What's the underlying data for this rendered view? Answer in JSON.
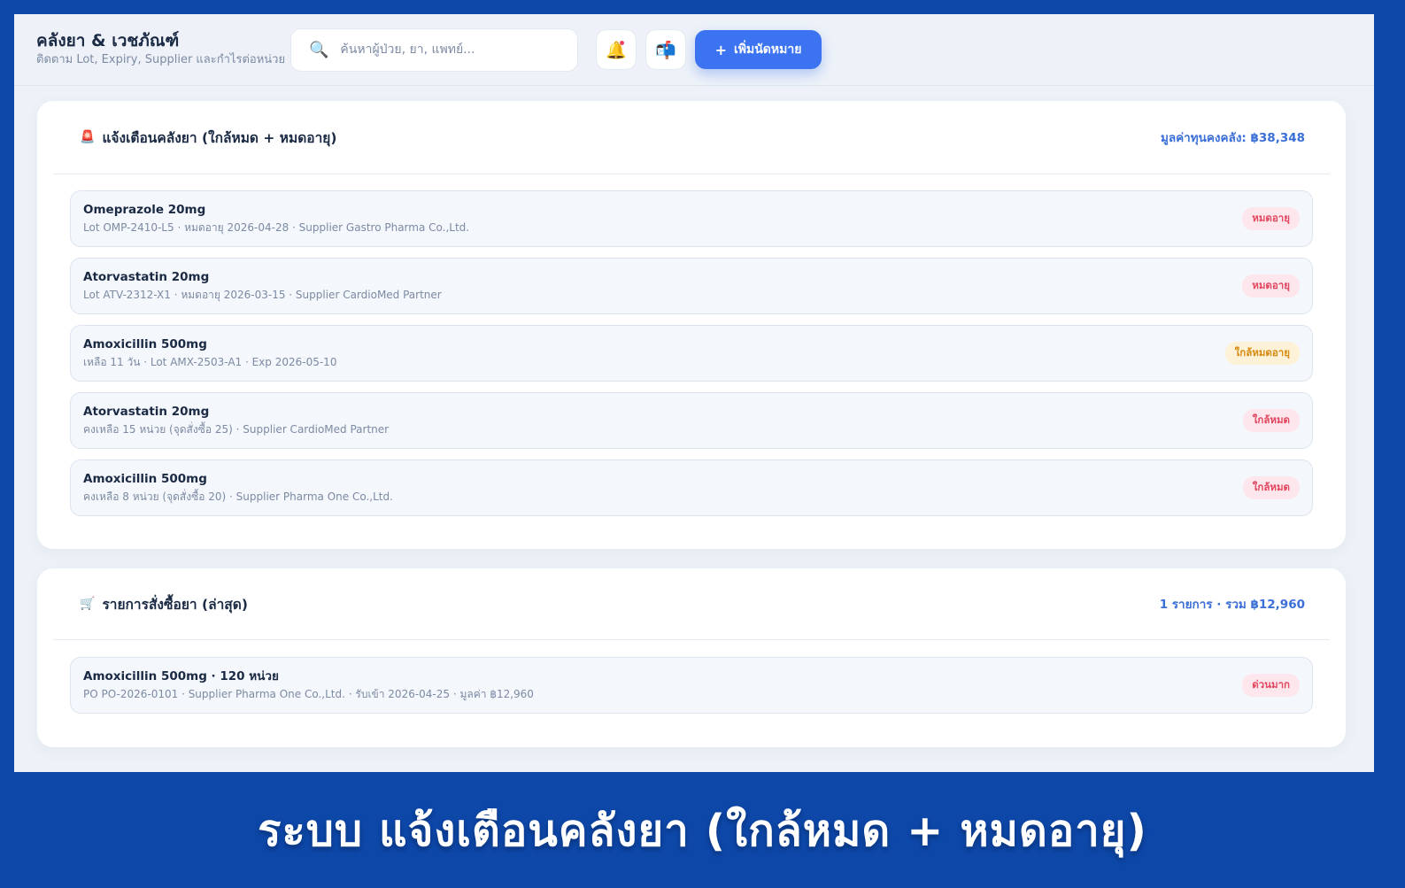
{
  "header": {
    "title": "คลังยา & เวชภัณฑ์",
    "subtitle": "ติดตาม Lot, Expiry, Supplier และกำไรต่อหน่วย",
    "search_placeholder": "ค้นหาผู้ป่วย, ยา, แพทย์...",
    "search_icon": "🔍",
    "bell_icon": "🔔",
    "mail_icon": "📬",
    "add_button_plus": "+",
    "add_button_label": "เพิ่มนัดหมาย"
  },
  "alerts": {
    "icon": "🚨",
    "title": "แจ้งเตือนคลังยา (ใกล้หมด + หมดอายุ)",
    "meta": "มูลค่าทุนคงคลัง: ฿38,348",
    "items": [
      {
        "name": "Omeprazole 20mg",
        "detail": "Lot OMP-2410-L5 · หมดอายุ 2026-04-28 · Supplier Gastro Pharma Co.,Ltd.",
        "badge": "หมดอายุ",
        "badge_tone": "red"
      },
      {
        "name": "Atorvastatin 20mg",
        "detail": "Lot ATV-2312-X1 · หมดอายุ 2026-03-15 · Supplier CardioMed Partner",
        "badge": "หมดอายุ",
        "badge_tone": "red"
      },
      {
        "name": "Amoxicillin 500mg",
        "detail": "เหลือ 11 วัน · Lot AMX-2503-A1 · Exp 2026-05-10",
        "badge": "ใกล้หมดอายุ",
        "badge_tone": "amber"
      },
      {
        "name": "Atorvastatin 20mg",
        "detail": "คงเหลือ 15 หน่วย (จุดสั่งซื้อ 25) · Supplier CardioMed Partner",
        "badge": "ใกล้หมด",
        "badge_tone": "red"
      },
      {
        "name": "Amoxicillin 500mg",
        "detail": "คงเหลือ 8 หน่วย (จุดสั่งซื้อ 20) · Supplier Pharma One Co.,Ltd.",
        "badge": "ใกล้หมด",
        "badge_tone": "red"
      }
    ]
  },
  "orders": {
    "icon": "🛒",
    "title": "รายการสั่งซื้อยา (ล่าสุด)",
    "meta": "1 รายการ · รวม ฿12,960",
    "items": [
      {
        "name": "Amoxicillin 500mg · 120 หน่วย",
        "detail": "PO PO-2026-0101 · Supplier Pharma One Co.,Ltd. · รับเข้า 2026-04-25 · มูลค่า ฿12,960",
        "badge": "ด่วนมาก",
        "badge_tone": "red"
      }
    ]
  },
  "caption": "ระบบ แจ้งเตือนคลังยา (ใกล้หมด + หมดอายุ)",
  "colors": {
    "accent": "#3b73f0",
    "frame": "#0d47a8",
    "badge_red": "#e2475f",
    "badge_amber": "#d68a10"
  }
}
